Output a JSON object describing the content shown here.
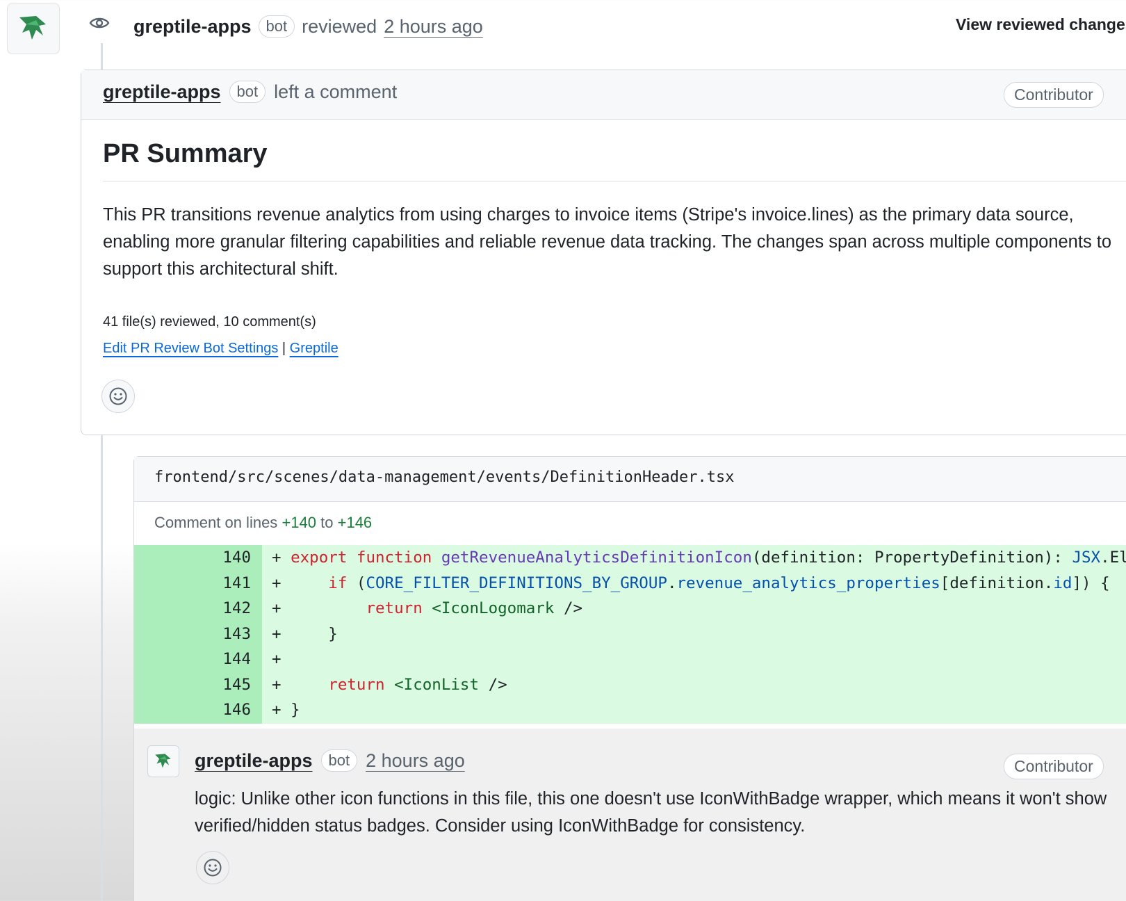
{
  "review_event": {
    "author": "greptile-apps",
    "bot_label": "bot",
    "action": "reviewed",
    "time": "2 hours ago",
    "view_changes_label": "View reviewed changes"
  },
  "comment": {
    "author": "greptile-apps",
    "bot_label": "bot",
    "action": "left a comment",
    "role_badge": "Contributor",
    "title": "PR Summary",
    "summary": "This PR transitions revenue analytics from using charges to invoice items (Stripe's invoice.lines) as the primary data source, enabling more granular filtering capabilities and reliable revenue data tracking. The changes span across multiple components to support this architectural shift.",
    "stats": "41 file(s) reviewed, 10 comment(s)",
    "settings_link": "Edit PR Review Bot Settings",
    "separator": "|",
    "greptile_link": "Greptile"
  },
  "thread": {
    "file_path": "frontend/src/scenes/data-management/events/DefinitionHeader.tsx",
    "range_prefix": "Comment on lines",
    "range_start": "+140",
    "range_to": "to",
    "range_end": "+146",
    "diff_lines": [
      {
        "num": "140",
        "code": "+ export function getRevenueAnalyticsDefinitionIcon(definition: PropertyDefinition): JSX.Element {"
      },
      {
        "num": "141",
        "code": "+     if (CORE_FILTER_DEFINITIONS_BY_GROUP.revenue_analytics_properties[definition.id]) {"
      },
      {
        "num": "142",
        "code": "+         return <IconLogomark />"
      },
      {
        "num": "143",
        "code": "+     }"
      },
      {
        "num": "144",
        "code": "+"
      },
      {
        "num": "145",
        "code": "+     return <IconList />"
      },
      {
        "num": "146",
        "code": "+ }"
      }
    ],
    "reply": {
      "author": "greptile-apps",
      "bot_label": "bot",
      "time": "2 hours ago",
      "role_badge": "Contributor",
      "text": "logic: Unlike other icon functions in this file, this one doesn't use IconWithBadge wrapper, which means it won't show verified/hidden status badges. Consider using IconWithBadge for consistency."
    }
  },
  "colors": {
    "added_gutter": "#aceebb",
    "added_code": "#dafbe1",
    "link_blue": "#0969da",
    "greptile_green": "#2f8a4f"
  }
}
